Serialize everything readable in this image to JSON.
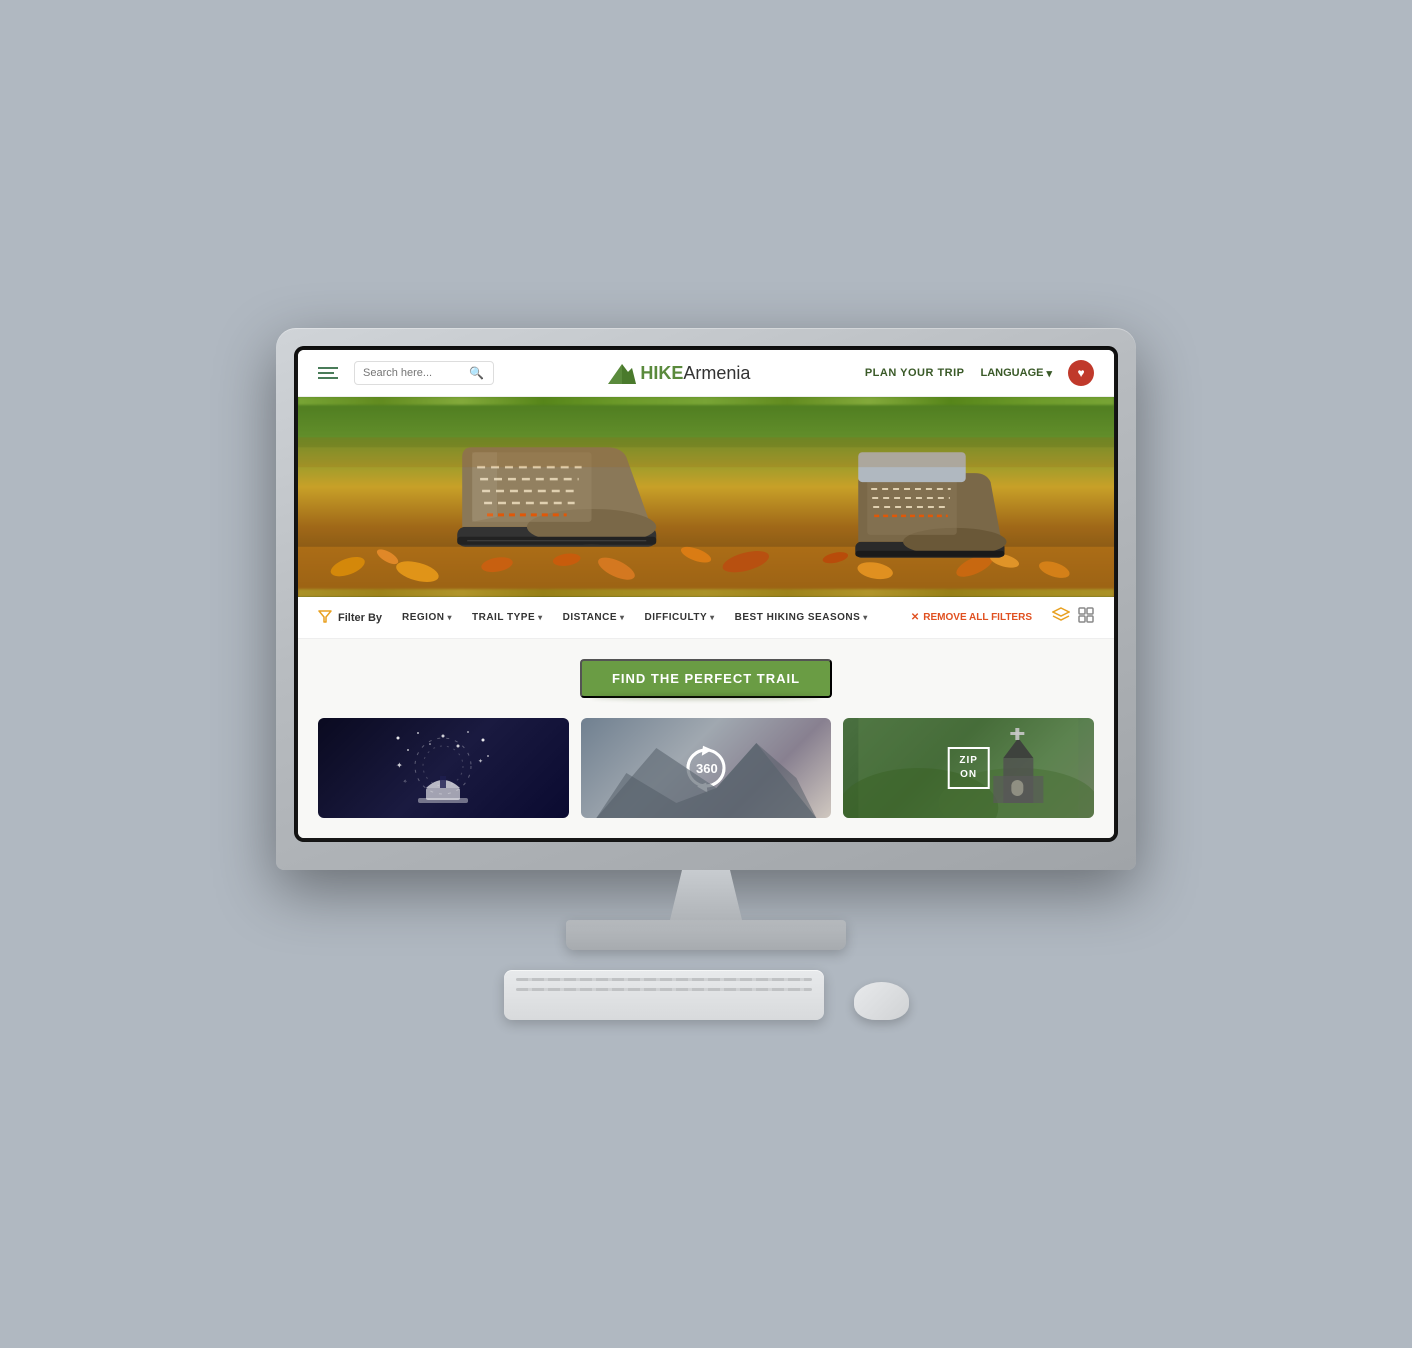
{
  "background": "#b0b8c1",
  "monitor": {
    "bezel_color": "#1a1a1a",
    "screen_bg": "#fff"
  },
  "website": {
    "nav": {
      "search_placeholder": "Search here...",
      "logo_hike": "HIKE",
      "logo_armenia": "Armenia",
      "plan_trip_label": "PLAN YOUR TRIP",
      "language_label": "LANGUAGE",
      "language_chevron": "▾"
    },
    "filters": {
      "filter_by_label": "Filter By",
      "region_label": "REGION",
      "trail_type_label": "TRAIL TYPE",
      "distance_label": "DISTANCE",
      "difficulty_label": "DIFFICULTY",
      "seasons_label": "BEST HIKING SEASONS",
      "remove_label": "REMOVE ALL FILTERS",
      "chevron": "▾"
    },
    "main": {
      "section_title": "FIND THE PERFECT TRAIL",
      "cards": [
        {
          "type": "stargazing",
          "label": "Stargazing"
        },
        {
          "type": "360",
          "label": "360° Views"
        },
        {
          "type": "zip",
          "label": "ZIP ON"
        }
      ]
    }
  },
  "icons": {
    "hamburger": "☰",
    "search": "🔍",
    "heart": "♥",
    "filter": "⧖",
    "chevron_down": "▾",
    "times": "×",
    "layers": "⊞",
    "grid": "⊟"
  }
}
